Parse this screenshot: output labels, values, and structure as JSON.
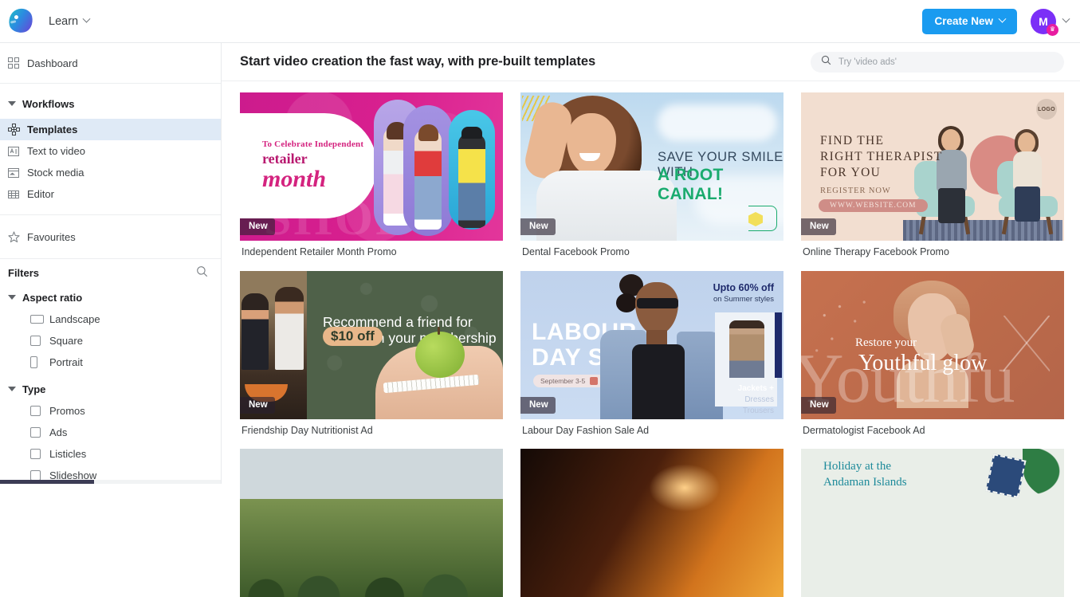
{
  "topbar": {
    "logo_icon": "app-logo-blob",
    "brand_label": "Learn",
    "brand_chevron_icon": "chevron-down-icon",
    "create_button_label": "Create New",
    "create_chevron_icon": "chevron-down-icon",
    "avatar_initial": "M",
    "avatar_badge_icon": "crown-icon",
    "avatar_chevron_icon": "chevron-down-icon"
  },
  "sidebar": {
    "dashboard": {
      "label": "Dashboard",
      "icon": "grid-squares-icon"
    },
    "workflows": {
      "label": "Workflows",
      "caret_icon": "caret-down-icon",
      "items": [
        {
          "label": "Templates",
          "icon": "templates-icon",
          "active": true
        },
        {
          "label": "Text to video",
          "icon": "text-to-video-icon",
          "active": false
        },
        {
          "label": "Stock media",
          "icon": "stock-media-icon",
          "active": false
        },
        {
          "label": "Editor",
          "icon": "editor-icon",
          "active": false
        }
      ]
    },
    "favourites": {
      "label": "Favourites",
      "icon": "star-icon"
    },
    "filters": {
      "label": "Filters",
      "search_icon": "search-icon",
      "groups": [
        {
          "label": "Aspect ratio",
          "caret_icon": "caret-down-icon",
          "options": [
            {
              "label": "Landscape",
              "checkbox_shape": "wide",
              "checked": false
            },
            {
              "label": "Square",
              "checkbox_shape": "square",
              "checked": false
            },
            {
              "label": "Portrait",
              "checkbox_shape": "tall",
              "checked": false
            }
          ]
        },
        {
          "label": "Type",
          "caret_icon": "caret-down-icon",
          "options": [
            {
              "label": "Promos",
              "checkbox_shape": "square",
              "checked": false
            },
            {
              "label": "Ads",
              "checkbox_shape": "square",
              "checked": false
            },
            {
              "label": "Listicles",
              "checkbox_shape": "square",
              "checked": false
            },
            {
              "label": "Slideshow",
              "checkbox_shape": "square",
              "checked": false
            }
          ]
        }
      ]
    }
  },
  "main": {
    "page_title": "Start video creation the fast way, with pre-built templates",
    "search": {
      "placeholder": "Try 'video ads'",
      "value": "",
      "icon": "search-icon"
    },
    "badge_new_label": "New",
    "cards": [
      {
        "caption": "Independent Retailer Month Promo",
        "badge": "New",
        "art": {
          "line1": "To Celebrate Independent",
          "line2": "retailer",
          "line3": "month",
          "bg_color": "#d9208f"
        }
      },
      {
        "caption": "Dental Facebook Promo",
        "badge": "New",
        "art": {
          "line1": "SAVE YOUR SMILE WITH",
          "line2": "A ROOT CANAL!",
          "accent_color": "#1aab6e",
          "bg_color": "#cfe4f3"
        }
      },
      {
        "caption": "Online Therapy Facebook Promo",
        "badge": "New",
        "art": {
          "logo_label": "LOGO",
          "line1": "FIND THE",
          "line2": "RIGHT THERAPIST",
          "line3": "FOR YOU",
          "cta": "REGISTER NOW",
          "url": "WWW.WEBSITE.COM",
          "bg_color": "#f2ded0"
        }
      },
      {
        "caption": "Friendship Day Nutritionist Ad",
        "badge": "New",
        "art": {
          "line1": "Recommend a friend for",
          "highlight": "$10 off",
          "line2": "on your membership",
          "bg_color": "#4f6149"
        }
      },
      {
        "caption": "Labour Day Fashion Sale Ad",
        "badge": "New",
        "art": {
          "line1": "LABOUR",
          "line2": "DAY SALE",
          "date": "September 3-5",
          "offer_title": "Upto 60% off",
          "offer_sub": "on Summer styles",
          "categories": [
            "Jackets  +",
            "Dresses",
            "Trousers"
          ],
          "bg_color": "#c5d6ef"
        }
      },
      {
        "caption": "Dermatologist Facebook Ad",
        "badge": "New",
        "art": {
          "line1": "Restore your",
          "line2": "Youthful glow",
          "watermark": "Youthfu",
          "bg_color": "#bb6a4a"
        }
      },
      {
        "caption": "",
        "badge": "",
        "art": {
          "bg_color": "#7b9350"
        }
      },
      {
        "caption": "",
        "badge": "",
        "art": {
          "bg_color": "#4a1f0c"
        }
      },
      {
        "caption": "",
        "badge": "",
        "art": {
          "line1": "Holiday at the",
          "line2": "Andaman Islands",
          "bg_color": "#e9eee8"
        }
      }
    ]
  }
}
